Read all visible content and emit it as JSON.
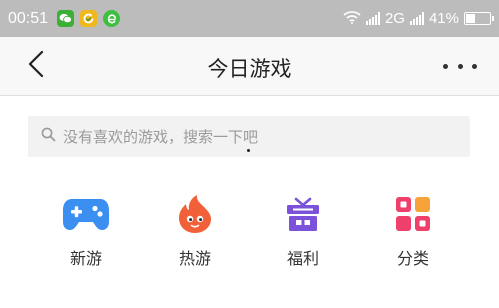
{
  "status_bar": {
    "time": "00:51",
    "network": "2G",
    "battery": "41%",
    "battery_level": 0.41,
    "app_icons": [
      "wechat-icon",
      "refresh-icon",
      "browser-e-icon"
    ]
  },
  "nav": {
    "title": "今日游戏"
  },
  "search": {
    "placeholder": "没有喜欢的游戏，搜索一下吧"
  },
  "categories": [
    {
      "label": "新游",
      "icon": "gamepad-icon",
      "color": "#3b8ff0"
    },
    {
      "label": "热游",
      "icon": "fire-icon",
      "color": "#f2603a"
    },
    {
      "label": "福利",
      "icon": "gift-icon",
      "color": "#7b52d9"
    },
    {
      "label": "分类",
      "icon": "category-grid-icon",
      "color": "#ef3f6b"
    }
  ],
  "colors": {
    "status_bar_bg": "#bcbcbc",
    "nav_bg": "#f8f8f8",
    "search_bg": "#f2f2f2"
  }
}
